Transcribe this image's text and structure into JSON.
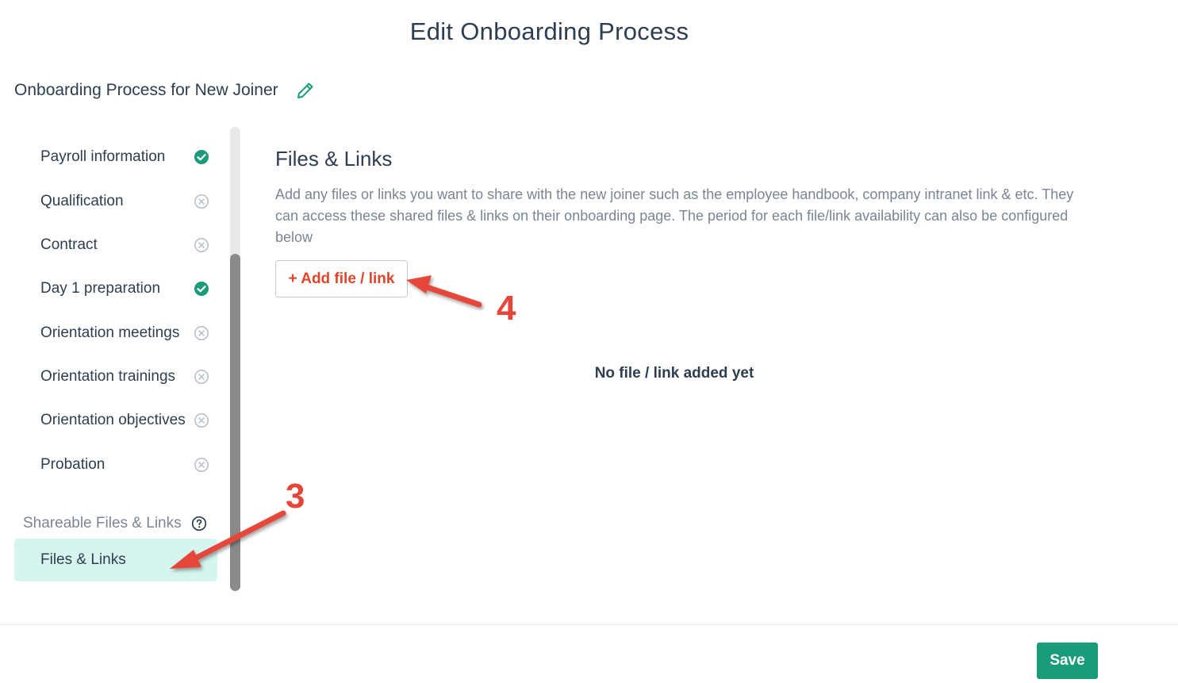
{
  "page": {
    "title": "Edit Onboarding Process"
  },
  "process": {
    "name": "Onboarding Process for New Joiner",
    "edit_icon": "pencil-icon"
  },
  "sidebar": {
    "steps": [
      {
        "label": "Payroll information",
        "status": "complete"
      },
      {
        "label": "Qualification",
        "status": "incomplete"
      },
      {
        "label": "Contract",
        "status": "incomplete"
      },
      {
        "label": "Day 1 preparation",
        "status": "complete"
      },
      {
        "label": "Orientation meetings",
        "status": "incomplete"
      },
      {
        "label": "Orientation trainings",
        "status": "incomplete"
      },
      {
        "label": "Orientation objectives",
        "status": "incomplete"
      },
      {
        "label": "Probation",
        "status": "incomplete"
      }
    ],
    "section_label": "Shareable Files & Links",
    "section_icon": "question-circle-icon",
    "active_item": "Files & Links"
  },
  "main": {
    "title": "Files & Links",
    "description": "Add any files or links you want to share with the new joiner such as the employee handbook, company intranet link & etc. They can access these shared files & links on their onboarding page. The period for each file/link availability can also be configured below",
    "add_button_label": "+ Add file / link",
    "empty_text": "No file / link added yet"
  },
  "footer": {
    "save_label": "Save"
  },
  "annotations": {
    "step3": "3",
    "step4": "4"
  },
  "colors": {
    "accent": "#1a9b79",
    "danger": "#e0452c",
    "active_bg": "#d6f5ee",
    "annotation": "#e5463a"
  }
}
